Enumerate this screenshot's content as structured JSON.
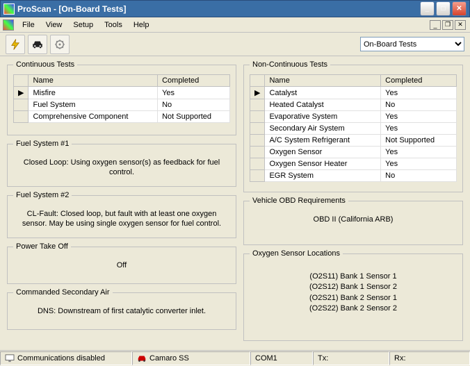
{
  "window": {
    "title": "ProScan - [On-Board Tests]"
  },
  "menu": {
    "file": "File",
    "view": "View",
    "setup": "Setup",
    "tools": "Tools",
    "help": "Help"
  },
  "toolbar": {
    "dropdown": "On-Board Tests"
  },
  "panels": {
    "continuous": {
      "legend": "Continuous Tests",
      "col_name": "Name",
      "col_completed": "Completed",
      "rows": [
        {
          "name": "Misfire",
          "completed": "Yes"
        },
        {
          "name": "Fuel System",
          "completed": "No"
        },
        {
          "name": "Comprehensive Component",
          "completed": "Not Supported"
        }
      ]
    },
    "noncontinuous": {
      "legend": "Non-Continuous Tests",
      "col_name": "Name",
      "col_completed": "Completed",
      "rows": [
        {
          "name": "Catalyst",
          "completed": "Yes"
        },
        {
          "name": "Heated Catalyst",
          "completed": "No"
        },
        {
          "name": "Evaporative System",
          "completed": "Yes"
        },
        {
          "name": "Secondary Air System",
          "completed": "Yes"
        },
        {
          "name": "A/C System Refrigerant",
          "completed": "Not Supported"
        },
        {
          "name": "Oxygen Sensor",
          "completed": "Yes"
        },
        {
          "name": "Oxygen Sensor Heater",
          "completed": "Yes"
        },
        {
          "name": "EGR System",
          "completed": "No"
        }
      ]
    },
    "fuel1": {
      "legend": "Fuel System #1",
      "text": "Closed Loop: Using oxygen sensor(s) as feedback for fuel control."
    },
    "fuel2": {
      "legend": "Fuel System #2",
      "text": "CL-Fault: Closed loop, but fault with at least one oxygen sensor. May be using single oxygen sensor for fuel control."
    },
    "pto": {
      "legend": "Power Take Off",
      "text": "Off"
    },
    "csa": {
      "legend": "Commanded Secondary Air",
      "text": "DNS: Downstream of first catalytic converter inlet."
    },
    "obd": {
      "legend": "Vehicle OBD Requirements",
      "text": "OBD II (California ARB)"
    },
    "oxy": {
      "legend": "Oxygen Sensor Locations",
      "lines": [
        "(O2S11) Bank 1 Sensor 1",
        "(O2S12) Bank 1 Sensor 2",
        "(O2S21) Bank 2 Sensor 1",
        "(O2S22) Bank 2 Sensor 2"
      ]
    }
  },
  "status": {
    "comm": "Communications disabled",
    "vehicle": "Camaro SS",
    "port": "COM1",
    "tx": "Tx:",
    "rx": "Rx:"
  }
}
